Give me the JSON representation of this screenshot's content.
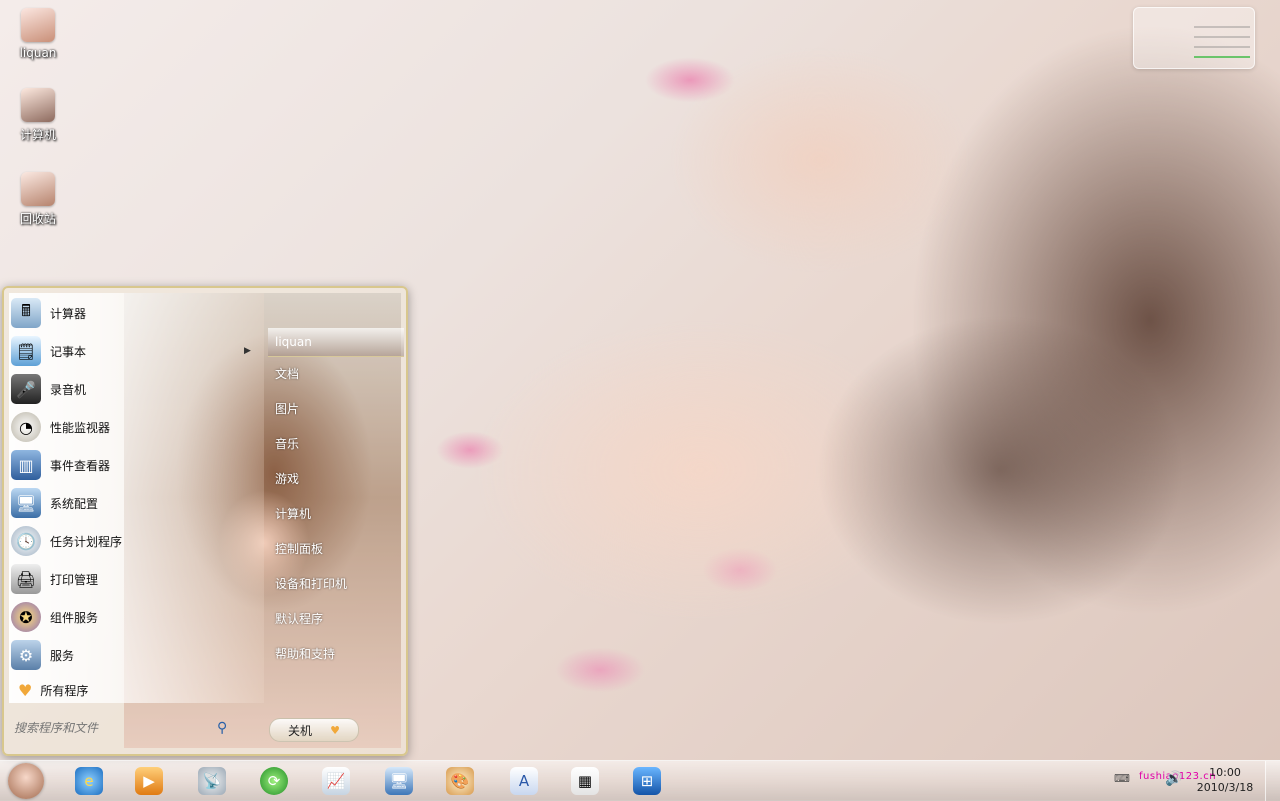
{
  "desktop": {
    "icons": [
      {
        "label": "liquan",
        "icon": "user-folder-icon"
      },
      {
        "label": "计算机",
        "icon": "computer-icon"
      },
      {
        "label": "回收站",
        "icon": "recycle-bin-icon"
      }
    ]
  },
  "start_menu": {
    "programs": [
      {
        "label": "计算器",
        "icon": "calculator-icon"
      },
      {
        "label": "记事本",
        "icon": "notepad-icon"
      },
      {
        "label": "录音机",
        "icon": "microphone-icon"
      },
      {
        "label": "性能监视器",
        "icon": "gauge-icon"
      },
      {
        "label": "事件查看器",
        "icon": "event-viewer-icon"
      },
      {
        "label": "系统配置",
        "icon": "system-config-icon"
      },
      {
        "label": "任务计划程序",
        "icon": "clock-icon"
      },
      {
        "label": "打印管理",
        "icon": "printer-icon"
      },
      {
        "label": "组件服务",
        "icon": "component-services-icon"
      },
      {
        "label": "服务",
        "icon": "gears-icon"
      }
    ],
    "all_programs": "所有程序",
    "search_placeholder": "搜索程序和文件",
    "right": {
      "user": "liquan",
      "items": [
        "文档",
        "图片",
        "音乐",
        "游戏",
        "计算机",
        "控制面板",
        "设备和打印机",
        "默认程序",
        "帮助和支持"
      ]
    },
    "shutdown_label": "关机"
  },
  "taskbar": {
    "pinned": [
      "internet-explorer-icon",
      "media-player-icon",
      "satellite-dish-icon",
      "refresh-icon",
      "chart-pen-icon",
      "monitor-icon",
      "paint-palette-icon",
      "document-icon",
      "picture-icon",
      "windows-icon"
    ],
    "tray_text": "fushiao123.cn",
    "time": "10:00",
    "date": "2010/3/18"
  },
  "colors": {
    "menu_border": "#d8c78d",
    "tray_text": "#e000a8"
  }
}
